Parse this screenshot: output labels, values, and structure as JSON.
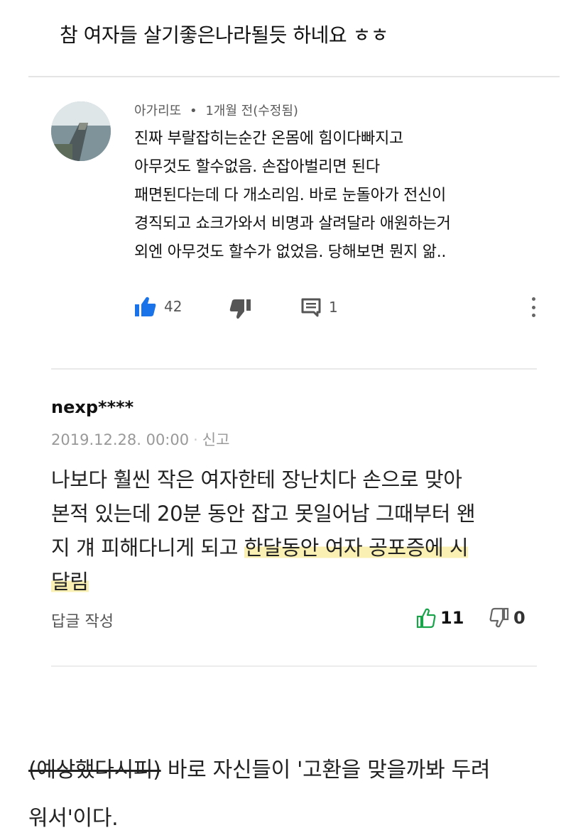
{
  "headline": "참 여자들 살기좋은나라될듯 하네요 ㅎㅎ",
  "comment1": {
    "author": "아가리또",
    "time": "1개월 전(수정됨)",
    "lines": [
      "진짜 부랄잡히는순간 온몸에 힘이다빠지고",
      "아무것도 할수없음. 손잡아벌리면 된다",
      "패면된다는데 다 개소리임. 바로 눈돌아가 전신이",
      "경직되고 쇼크가와서 비명과 살려달라 애원하는거",
      "외엔 아무것도 할수가 없었음. 당해보면 뭔지 앎.."
    ],
    "like_count": "42",
    "reply_count": "1",
    "icons": [
      "thumbs-up-icon",
      "thumbs-down-icon",
      "reply-icon",
      "more-icon"
    ],
    "accent_color": "#1a73e8"
  },
  "comment2": {
    "nickname": "nexp****",
    "date": "2019.12.28. 00:00",
    "report": "신고",
    "line1": "나보다 훨씬 작은 여자한테 장난치다 손으로 맞아",
    "line2": "본적 있는데 20분 동안 잡고 못일어남 그때부터 왠",
    "line3_plain": "지 걔 피해다니게 되고 ",
    "line3_highlight": "한달동안 여자 공포증에 시",
    "line4_highlight": "달림",
    "reply_label": "답글 작성",
    "like_count": "11",
    "dislike_count": "0",
    "like_color": "#19a34a",
    "highlight_color": "#fbf0b3"
  },
  "caption": {
    "strike_text": "(예상했다시피)",
    "text_line1": " 바로 자신들이 '고환을 맞을까봐 두려",
    "text_line2": "워서'이다."
  }
}
